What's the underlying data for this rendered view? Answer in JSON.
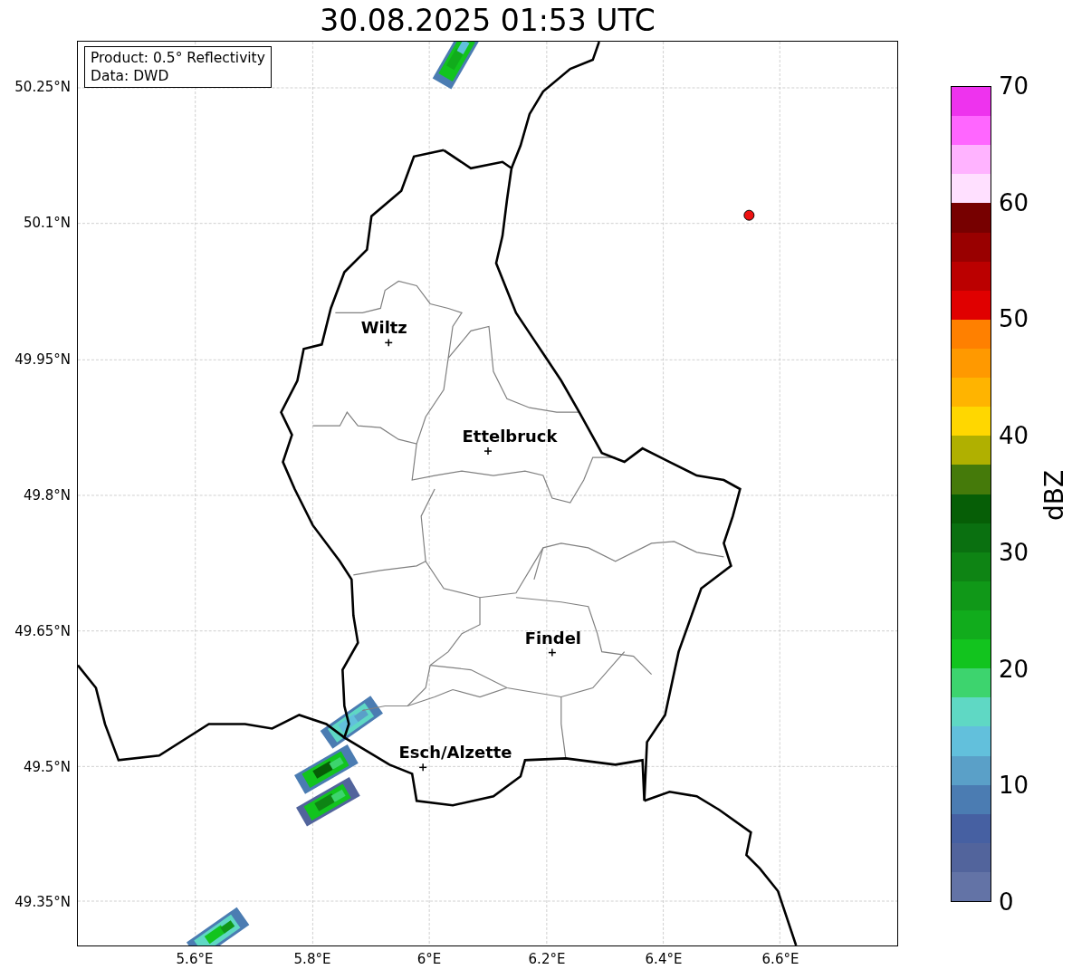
{
  "title": "30.08.2025 01:53 UTC",
  "info_box": [
    "Product: 0.5° Reflectivity",
    "Data: DWD"
  ],
  "map": {
    "lat_labels": [
      "50.25°N",
      "50.1°N",
      "49.95°N",
      "49.8°N",
      "49.65°N",
      "49.5°N",
      "49.35°N"
    ],
    "lon_labels": [
      "5.6°E",
      "5.8°E",
      "6°E",
      "6.2°E",
      "6.4°E",
      "6.6°E"
    ],
    "cities": [
      {
        "name": "Wiltz"
      },
      {
        "name": "Ettelbruck"
      },
      {
        "name": "Findel"
      },
      {
        "name": "Esch/Alzette"
      }
    ]
  },
  "colorbar": {
    "label": "dBZ",
    "ticks": [
      "70",
      "60",
      "50",
      "40",
      "30",
      "20",
      "10",
      "0"
    ],
    "segments": [
      {
        "color": "#ee33ee"
      },
      {
        "color": "#ff66ff"
      },
      {
        "color": "#ffb3ff"
      },
      {
        "color": "#ffe0ff"
      },
      {
        "color": "#770000"
      },
      {
        "color": "#990000"
      },
      {
        "color": "#bb0000"
      },
      {
        "color": "#e00000"
      },
      {
        "color": "#ff8000"
      },
      {
        "color": "#ff9900"
      },
      {
        "color": "#ffb400"
      },
      {
        "color": "#ffd700"
      },
      {
        "color": "#b0b000"
      },
      {
        "color": "#457a0a"
      },
      {
        "color": "#065e06"
      },
      {
        "color": "#0a7010"
      },
      {
        "color": "#0e8414"
      },
      {
        "color": "#109818"
      },
      {
        "color": "#11ac1c"
      },
      {
        "color": "#12c41e"
      },
      {
        "color": "#3dd46e"
      },
      {
        "color": "#5fd8c4"
      },
      {
        "color": "#62c0dc"
      },
      {
        "color": "#5aa0c8"
      },
      {
        "color": "#4b7cb2"
      },
      {
        "color": "#4660a2"
      },
      {
        "color": "#52649c"
      },
      {
        "color": "#6373a6"
      }
    ]
  }
}
